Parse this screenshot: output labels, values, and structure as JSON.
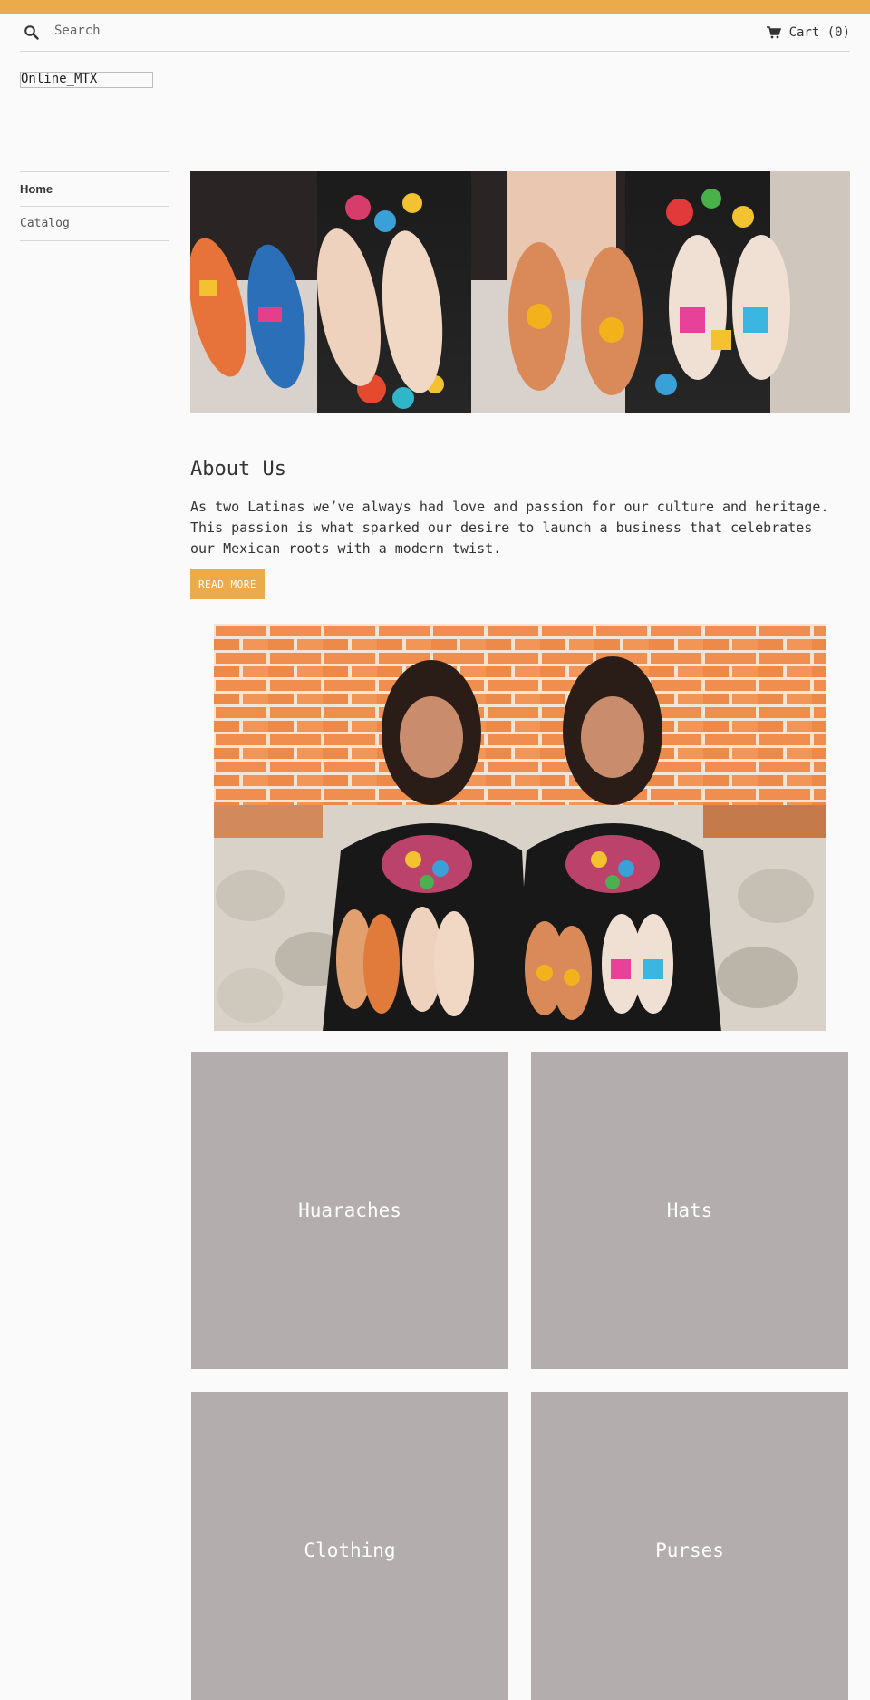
{
  "header": {
    "search_placeholder": "Search",
    "cart_label": "Cart (0)"
  },
  "brand": {
    "logo_text": "Online_MTX"
  },
  "nav": {
    "items": [
      {
        "label": "Home",
        "active": true
      },
      {
        "label": "Catalog",
        "active": false
      }
    ]
  },
  "about": {
    "title": "About Us",
    "text": "As two Latinas we’ve always had love and passion for our culture and heritage. This passion is what sparked our desire to launch a business that celebrates our Mexican roots with a modern twist.",
    "button": "READ MORE"
  },
  "collections": [
    {
      "label": "Huaraches"
    },
    {
      "label": "Hats"
    },
    {
      "label": "Clothing"
    },
    {
      "label": "Purses"
    }
  ],
  "colors": {
    "accent": "#ebab4a",
    "tile": "#b3adad",
    "background": "#fafafa"
  },
  "icons": {
    "search": "search-icon",
    "cart": "cart-icon"
  }
}
